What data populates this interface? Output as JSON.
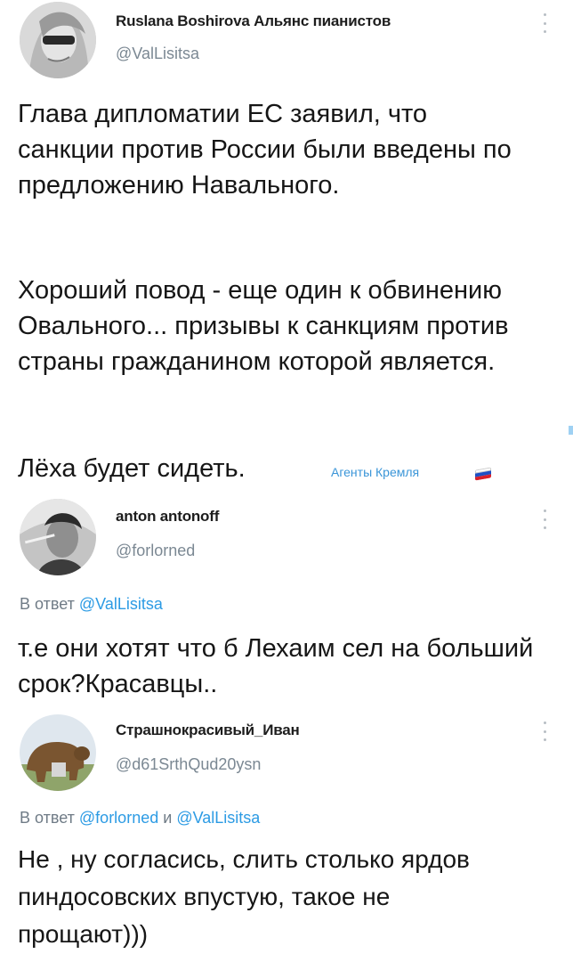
{
  "tweets": [
    {
      "name": "Ruslana Boshirova Альянс пианистов",
      "handle": "@ValLisitsa",
      "paragraphs": [
        "Глава дипломатии ЕС заявил, что санкции против России были введены по предложению Навального.",
        "Хороший повод - еще один к обвинению Овального... призывы к санкциям против страны гражданином которой является.",
        "Лёха будет сидеть."
      ],
      "badge": "Агенты Кремля"
    },
    {
      "name": "anton antonoff",
      "handle": "@forlorned",
      "reply_prefix": "В ответ",
      "reply_mentions": [
        "@ValLisitsa"
      ],
      "text": "т.е они хотят что б Лехаим сел на больший срок?Красавцы.."
    },
    {
      "name": "Страшнокрасивый_Иван",
      "handle": "@d61SrthQud20ysn",
      "reply_prefix": "В ответ",
      "reply_mentions": [
        "@forlorned",
        "@ValLisitsa"
      ],
      "reply_joiner": "и",
      "text": "Не , ну согласись, слить столько ярдов пиндосовских впустую, такое не прощают)))"
    }
  ],
  "colors": {
    "mention": "#2c9be4",
    "handle": "#7b8893",
    "flag": [
      "#ffffff",
      "#1d4fc4",
      "#d8202a"
    ]
  },
  "icons": [
    "more-vertical-icon",
    "russian-flag-icon"
  ]
}
